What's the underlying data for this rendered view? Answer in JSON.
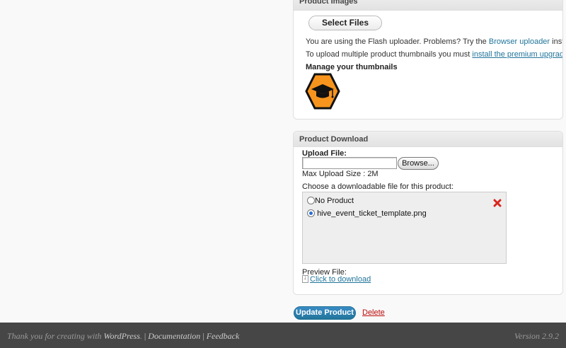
{
  "product_images": {
    "title": "Product Images",
    "select_files_label": "Select Files",
    "flash_text_before": "You are using the Flash uploader. Problems? Try the ",
    "browser_uploader_link": "Browser uploader",
    "flash_text_after": " instead.",
    "multiple_text": "To upload multiple product thumbnails you must ",
    "premium_link": "install the premium upgrade",
    "manage_label": "Manage your thumbnails",
    "thumbnail_icon": "graduation-cap-hexagon-icon"
  },
  "product_download": {
    "title": "Product Download",
    "upload_file_label": "Upload File:",
    "file_input_value": "",
    "browse_label": "Browse...",
    "max_upload_label": "Max Upload Size : 2M",
    "choose_label": "Choose a downloadable file for this product:",
    "files": [
      {
        "label": "No Product",
        "checked": false
      },
      {
        "label": "hive_event_ticket_template.png",
        "checked": true
      }
    ],
    "preview_label": "Preview File:",
    "preview_link": "Click to download"
  },
  "actions": {
    "update_label": "Update Product",
    "delete_label": "Delete"
  },
  "footer": {
    "thanks_prefix": "Thank you for creating with ",
    "wordpress_link": "WordPress",
    "thanks_suffix": ".",
    "separator": " | ",
    "documentation_link": "Documentation",
    "feedback_link": "Feedback",
    "version": "Version 2.9.2"
  },
  "colors": {
    "accent_blue": "#21759b",
    "delete_red": "#bc0b0b",
    "footer_bg": "#464646",
    "thumbnail_orange": "#f7941d"
  }
}
